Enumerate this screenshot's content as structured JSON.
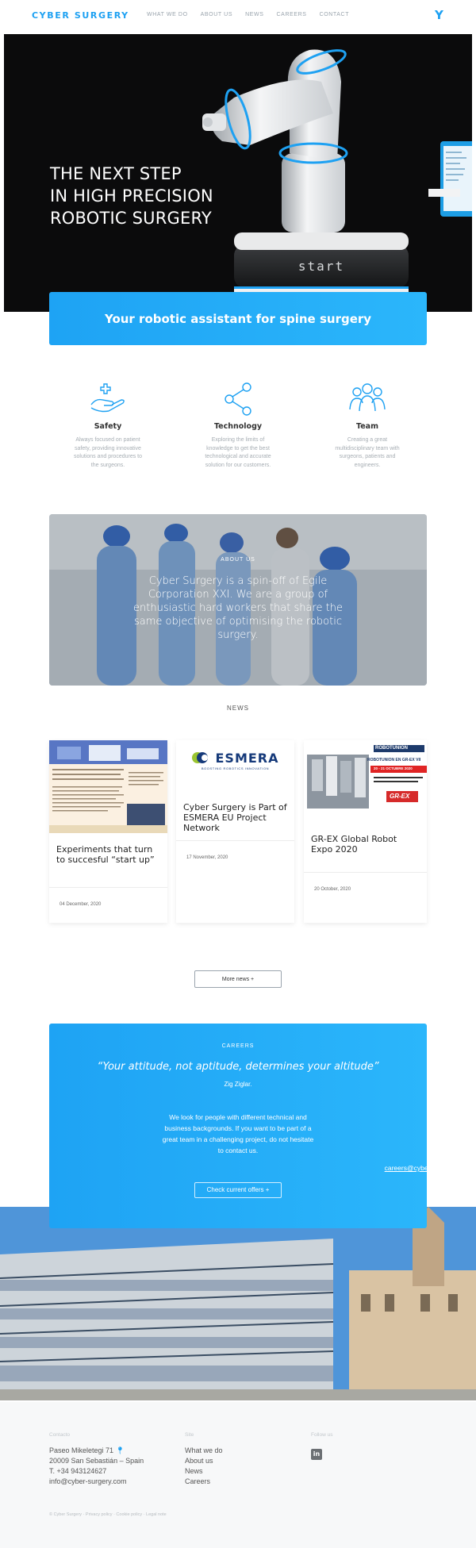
{
  "brand": {
    "name": "CYBER SURGERY",
    "accent": "#1ea1f2"
  },
  "nav": {
    "items": [
      "WHAT WE DO",
      "ABOUT US",
      "NEWS",
      "CAREERS",
      "CONTACT"
    ],
    "icon": "y-logo-icon",
    "icon_glyph": "Y"
  },
  "hero": {
    "title_lines": [
      "THE NEXT STEP",
      "IN HIGH PRECISION",
      "ROBOTIC SURGERY"
    ],
    "robot_screen_text": "start",
    "banner": "Your robotic assistant for spine surgery"
  },
  "features": [
    {
      "title": "Safety",
      "icon": "hand-cross-icon",
      "text": "Always focused on patient safety, providing innovative solutions and procedures to the surgeons."
    },
    {
      "title": "Technology",
      "icon": "share-nodes-icon",
      "text": "Exploring the limits of knowledge to get the best technological and accurate solution for our customers."
    },
    {
      "title": "Team",
      "icon": "team-icon",
      "text": "Creating a great multidisciplinary team with surgeons, patients and engineers."
    }
  ],
  "about": {
    "label": "ABOUT US",
    "text": "Cyber Surgery is a spin-off of Egile Corporation XXI. We are a group of enthusiastic hard workers that share the same objective of optimising the robotic surgery."
  },
  "news": {
    "heading": "NEWS",
    "cards": [
      {
        "title": "Experiments that turn to succesful “start up”",
        "date": "04 December, 2020"
      },
      {
        "title": "Cyber Surgery is Part of ESMERA EU Project Network",
        "date": "17 November, 2020",
        "logo_main": "ESMERA",
        "logo_sub": "BOOSTING ROBOTICS INNOVATION"
      },
      {
        "title": "GR-EX Global Robot Expo 2020",
        "date": "20 October, 2020",
        "logo": "ROBOTUNION",
        "headline": "ROBOTUNION EN GR-EX VII",
        "dates": "20 - 21 OCTUBRE 2020",
        "grex": "GR-EX"
      }
    ],
    "more": "More news +"
  },
  "careers": {
    "label": "CAREERS",
    "quote": "“Your attitude, not aptitude, determines your altitude”",
    "author": "Zig Ziglar.",
    "desc": "We look for people with different technical and business backgrounds. If you want to be part of a great team in a challenging project, do not hesitate to contact us.",
    "email": "careers@cyber-surgery.com",
    "button": "Check current offers +"
  },
  "footer": {
    "contact_heading": "Contacto",
    "address1": "Paseo Mikeletegi 71",
    "address2": "20009 San Sebastián – Spain",
    "phone": "T. +34 943124627",
    "email": "info@cyber-surgery.com",
    "site_heading": "Site",
    "site_links": [
      "What we do",
      "About us",
      "News",
      "Careers"
    ],
    "follow_heading": "Follow us",
    "social_icon": "linkedin-icon",
    "social_glyph": "in",
    "bottom": "© Cyber Surgery · Privacy policy · Cookie policy · Legal note"
  }
}
